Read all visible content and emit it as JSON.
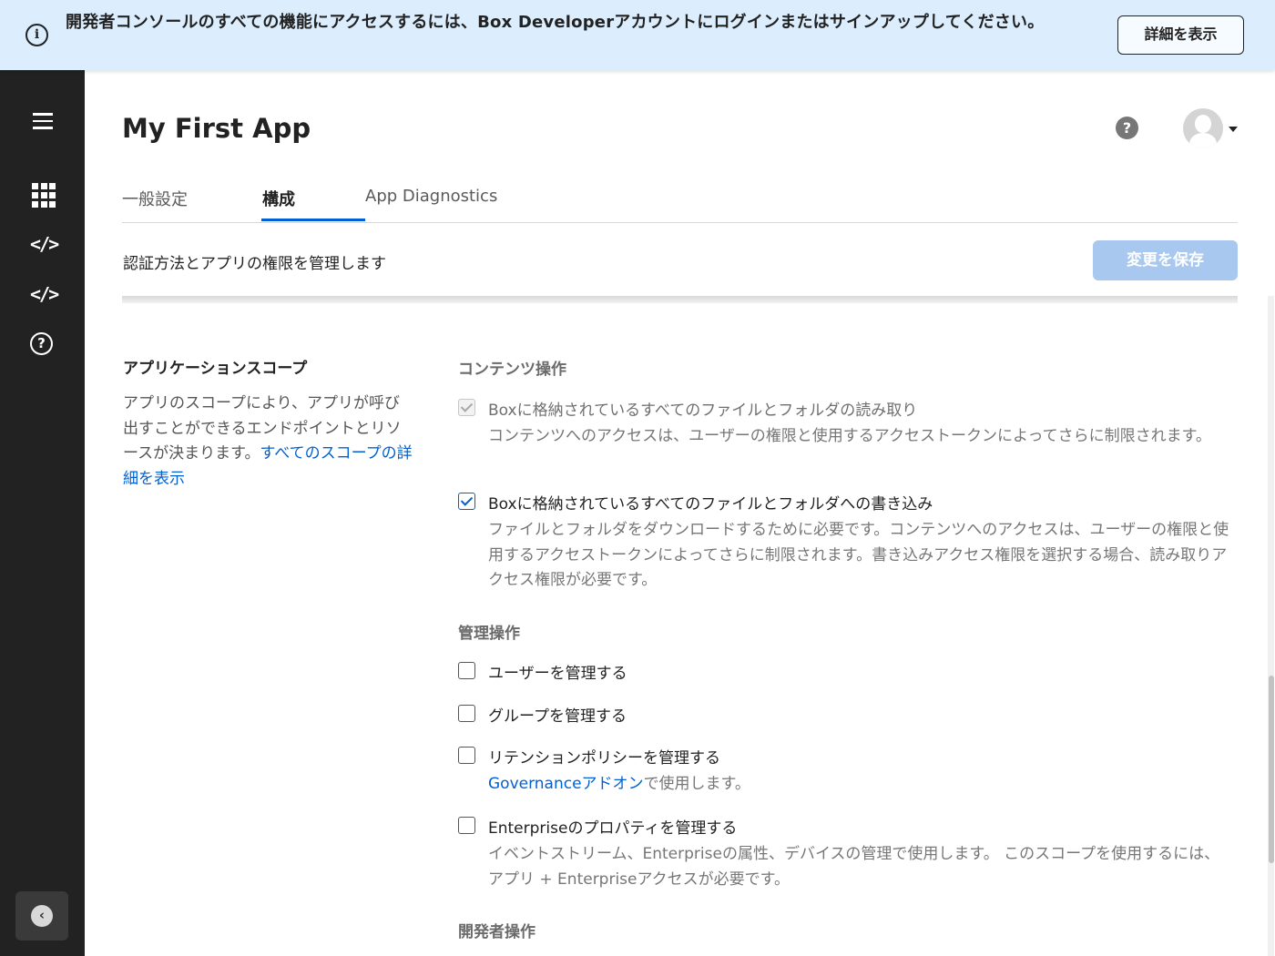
{
  "banner": {
    "icon": "info-icon",
    "message": "開発者コンソールのすべての機能にアクセスするには、Box Developerアカウントにログインまたはサインアップしてください。",
    "button_label": "詳細を表示"
  },
  "sidebar": {
    "icons": [
      "menu-icon",
      "apps-grid-icon",
      "code-icon",
      "code-icon",
      "help-circle-icon"
    ],
    "collapse_icon": "chevron-left-icon"
  },
  "header": {
    "title": "My First App",
    "help_icon": "question-icon",
    "avatar_icon": "user-avatar-icon"
  },
  "tabs": [
    {
      "label": "一般設定",
      "active": false
    },
    {
      "label": "構成",
      "active": true
    },
    {
      "label": "App Diagnostics",
      "active": false
    }
  ],
  "subheader": {
    "text": "認証方法とアプリの権限を管理します",
    "save_label": "変更を保存"
  },
  "scopes": {
    "title": "アプリケーションスコープ",
    "description": "アプリのスコープにより、アプリが呼び出すことができるエンドポイントとリソースが決まります。",
    "link": "すべてのスコープの詳細を表示"
  },
  "content_ops": {
    "title": "コンテンツ操作",
    "items": [
      {
        "label": "Boxに格納されているすべてのファイルとフォルダの読み取り",
        "checked": true,
        "disabled": true,
        "desc": "コンテンツへのアクセスは、ユーザーの権限と使用するアクセストークンによってさらに制限されます。"
      },
      {
        "label": "Boxに格納されているすべてのファイルとフォルダへの書き込み",
        "checked": true,
        "disabled": false,
        "desc": "ファイルとフォルダをダウンロードするために必要です。コンテンツへのアクセスは、ユーザーの権限と使用するアクセストークンによってさらに制限されます。書き込みアクセス権限を選択する場合、読み取りアクセス権限が必要です。"
      }
    ]
  },
  "admin_ops": {
    "title": "管理操作",
    "items": [
      {
        "label": "ユーザーを管理する",
        "checked": false
      },
      {
        "label": "グループを管理する",
        "checked": false
      },
      {
        "label": "リテンションポリシーを管理する",
        "checked": false,
        "desc_link": "Governanceアドオン",
        "desc_suffix": "で使用します。"
      },
      {
        "label": "Enterpriseのプロパティを管理する",
        "checked": false,
        "desc": "イベントストリーム、Enterpriseの属性、デバイスの管理で使用します。 このスコープを使用するには、アプリ + Enterpriseアクセスが必要です。"
      }
    ]
  },
  "dev_ops": {
    "title": "開発者操作"
  },
  "colors": {
    "accent": "#0061d5",
    "sidebar_bg": "#222222",
    "banner_bg": "#dceefe",
    "save_disabled": "#a8c8f0"
  }
}
